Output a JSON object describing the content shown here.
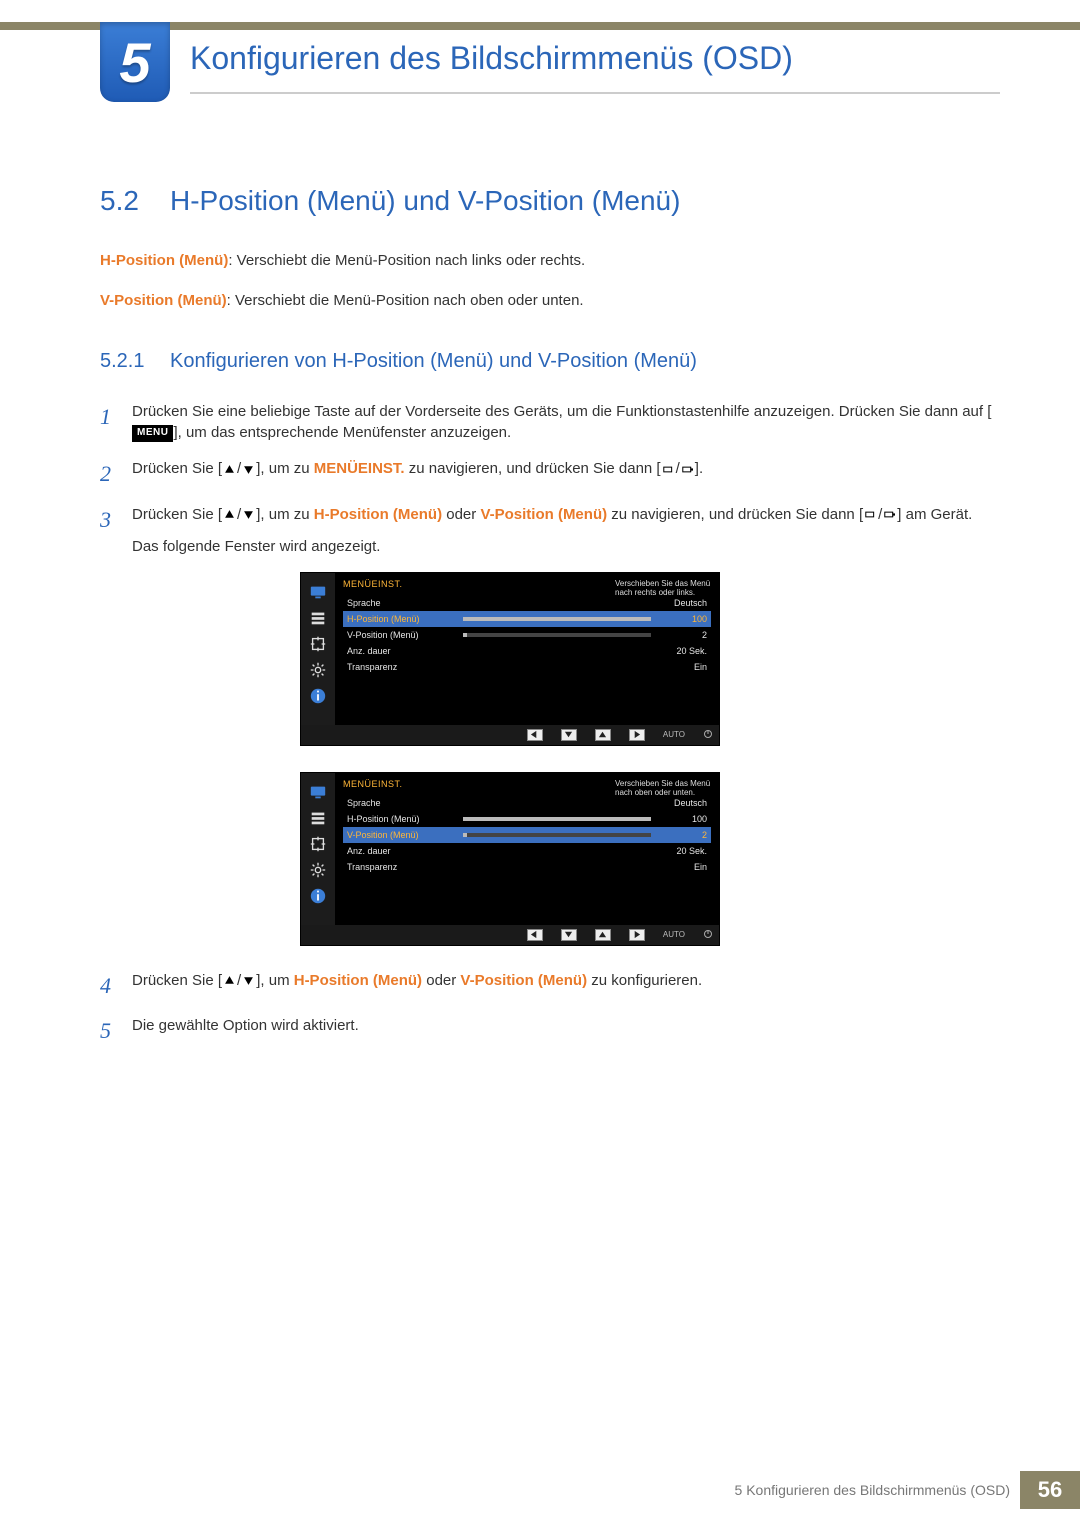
{
  "chapter": {
    "number": "5",
    "title": "Konfigurieren des Bildschirmmenüs (OSD)"
  },
  "section": {
    "number": "5.2",
    "title": "H-Position (Menü) und V-Position (Menü)"
  },
  "intro": {
    "hpos_label": "H-Position (Menü)",
    "hpos_text": ": Verschiebt die Menü-Position nach links oder rechts.",
    "vpos_label": "V-Position (Menü)",
    "vpos_text": ": Verschiebt die Menü-Position nach oben oder unten."
  },
  "subsection": {
    "number": "5.2.1",
    "title": "Konfigurieren von H-Position (Menü) und V-Position (Menü)"
  },
  "steps": {
    "s1a": "Drücken Sie eine beliebige Taste auf der Vorderseite des Geräts, um die Funktionstastenhilfe anzuzeigen. Drücken Sie dann auf [",
    "s1b": "], um das entsprechende Menüfenster anzuzeigen.",
    "menu_btn": "MENU",
    "s2a": "Drücken Sie [",
    "s2b": "], um zu ",
    "s2_emph": "MENÜEINST.",
    "s2c": " zu navigieren, und drücken Sie dann [",
    "s2d": "].",
    "s3a": "Drücken Sie [",
    "s3b": "], um zu ",
    "s3_h": "H-Position (Menü)",
    "s3_or": " oder ",
    "s3_v": "V-Position (Menü)",
    "s3c": " zu navigieren, und drücken Sie dann [",
    "s3d": "] am Gerät.",
    "s3e": "Das folgende Fenster wird angezeigt.",
    "s4a": "Drücken Sie [",
    "s4b": "], um ",
    "s4_h": "H-Position (Menü)",
    "s4_or": " oder ",
    "s4_v": "V-Position (Menü)",
    "s4c": " zu konfigurieren.",
    "s5": "Die gewählte Option wird aktiviert."
  },
  "osd_common": {
    "title": "MENÜEINST.",
    "rows": {
      "lang": "Sprache",
      "lang_val": "Deutsch",
      "hpos": "H-Position (Menü)",
      "hpos_val": "100",
      "vpos": "V-Position (Menü)",
      "vpos_val": "2",
      "dur": "Anz. dauer",
      "dur_val": "20 Sek.",
      "trans": "Transparenz",
      "trans_val": "Ein"
    },
    "nav_auto": "AUTO"
  },
  "osd1": {
    "info": "Verschieben Sie das Menü nach rechts oder links."
  },
  "osd2": {
    "info": "Verschieben Sie das Menü nach oben oder unten."
  },
  "footer": {
    "text": "5 Konfigurieren des Bildschirmmenüs (OSD)",
    "page": "56"
  }
}
